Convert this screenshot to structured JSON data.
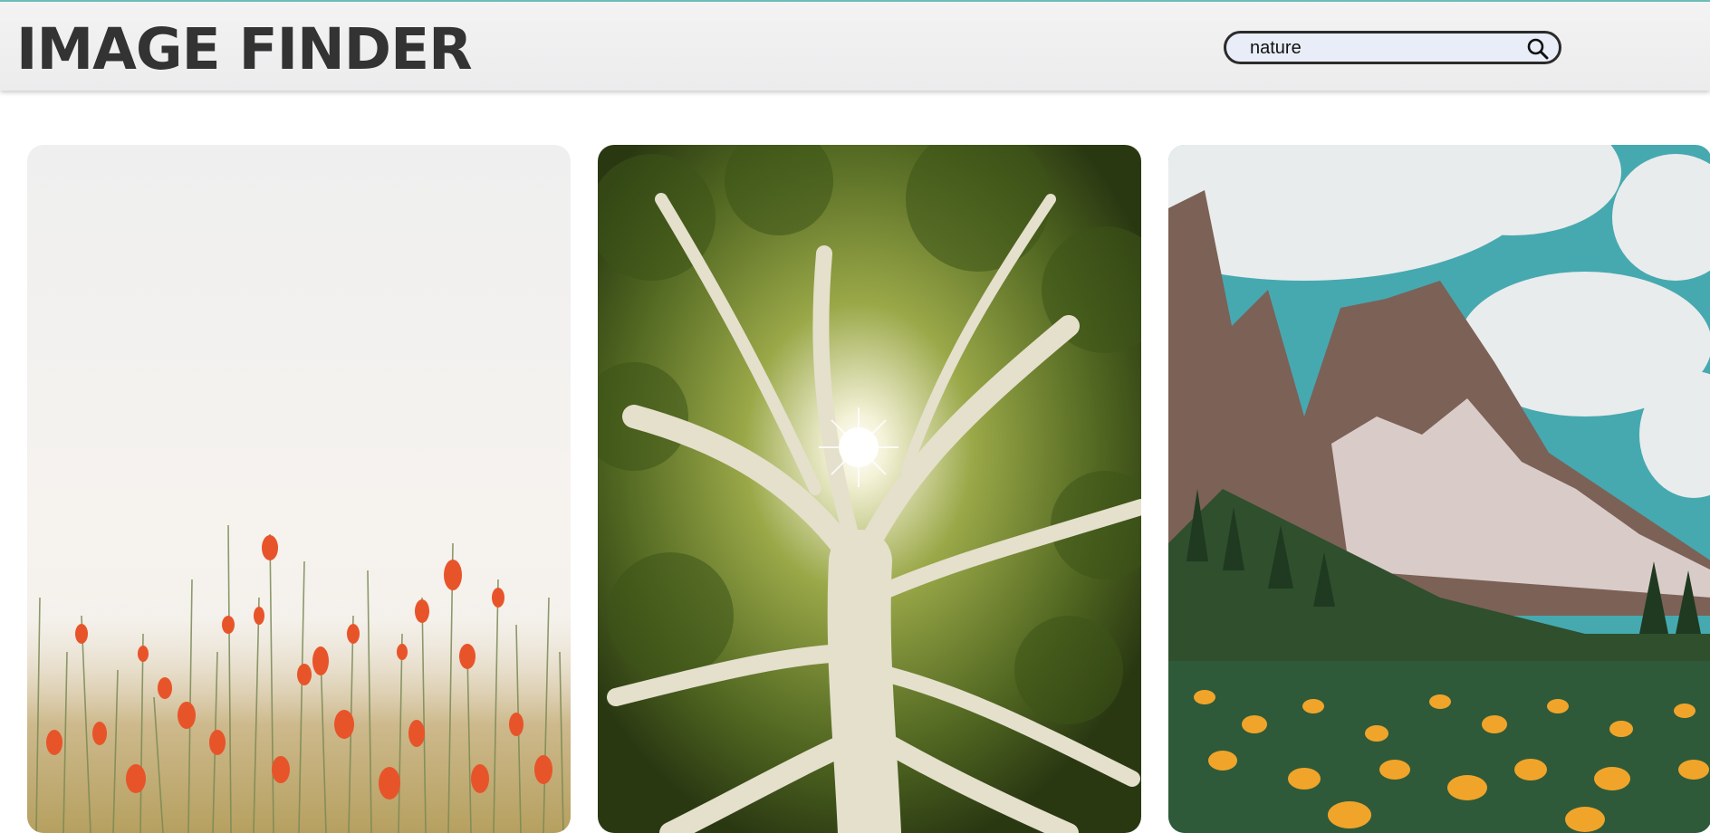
{
  "header": {
    "title": "IMAGE FINDER",
    "search_value": "nature",
    "search_icon": "search-icon",
    "accent_color": "#6bbdb8"
  },
  "gallery": {
    "images": [
      {
        "subject": "poppy-field-image",
        "icon": "image"
      },
      {
        "subject": "tree-canopy-image",
        "icon": "image"
      },
      {
        "subject": "mountain-meadow-image",
        "icon": "image"
      }
    ]
  }
}
